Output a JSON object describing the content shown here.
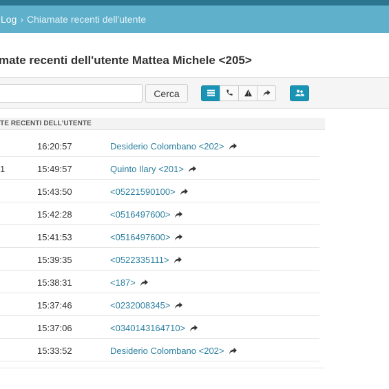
{
  "breadcrumb": {
    "parent": "Log",
    "separator": "›",
    "current": "Chiamate recenti dell'utente"
  },
  "page": {
    "title": "mate recenti dell'utente Mattea Michele <205>"
  },
  "toolbar": {
    "search_value": "",
    "search_label": "Cerca",
    "view_buttons": [
      "list-icon",
      "phone-icon",
      "warning-icon",
      "forward-icon"
    ],
    "users_button_icon": "users-icon",
    "accent_color": "#1a94b5"
  },
  "table": {
    "header": "TE RECENTI DELL'UTENTE",
    "rows": [
      {
        "col1": "",
        "time": "16:20:57",
        "number": "Desiderio Colombano <202>"
      },
      {
        "col1": "1",
        "time": "15:49:57",
        "number": "Quinto Ilary <201>"
      },
      {
        "col1": "",
        "time": "15:43:50",
        "number": "<05221590100>"
      },
      {
        "col1": "",
        "time": "15:42:28",
        "number": "<0516497600>"
      },
      {
        "col1": "",
        "time": "15:41:53",
        "number": "<0516497600>"
      },
      {
        "col1": "",
        "time": "15:39:35",
        "number": "<0522335111>"
      },
      {
        "col1": "",
        "time": "15:38:31",
        "number": "<187>"
      },
      {
        "col1": "",
        "time": "15:37:46",
        "number": "<0232008345>"
      },
      {
        "col1": "",
        "time": "15:37:06",
        "number": "<0340143164710>"
      },
      {
        "col1": "",
        "time": "15:33:52",
        "number": "Desiderio Colombano <202>"
      }
    ]
  }
}
